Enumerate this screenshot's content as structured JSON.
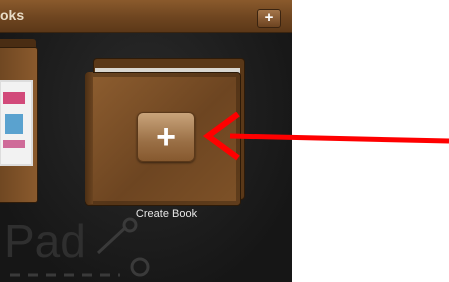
{
  "nav": {
    "title": "oks",
    "add_label": "+"
  },
  "album": {
    "button_label": "+",
    "caption": "Create Book"
  },
  "colors": {
    "nav_brown": "#6e4520",
    "cover_brown": "#7e5228",
    "button_tan": "#b08658",
    "arrow_red": "#ff0000",
    "background": "#1c1c1c"
  },
  "icons": {
    "watermark": "ipad-logo-icon",
    "arrow": "red-arrow-icon"
  }
}
